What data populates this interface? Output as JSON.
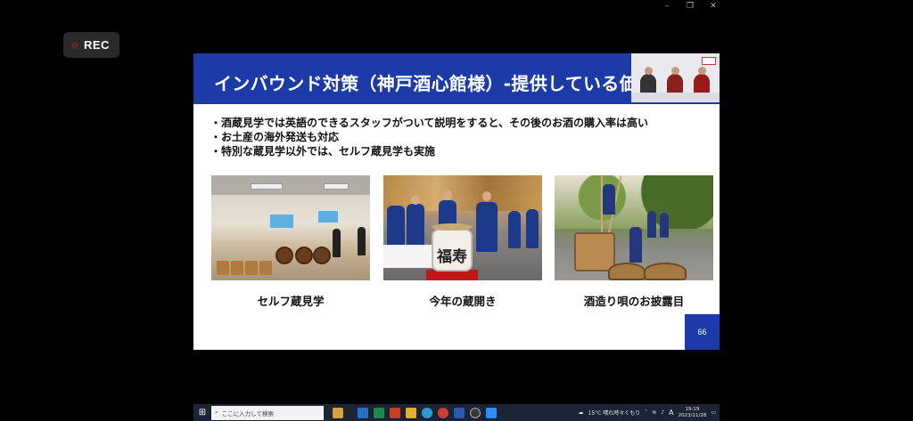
{
  "window": {
    "controls": [
      "–",
      "❐",
      "✕"
    ]
  },
  "rec_badge": {
    "label": "REC"
  },
  "slide": {
    "title": "インバウンド対策（神戸酒心館様）-提供している価",
    "bullets": [
      "酒蔵見学では英語のできるスタッフがついて説明をすると、その後のお酒の購入率は高い",
      "お土産の海外発送も対応",
      "特別な蔵見学以外では、セルフ蔵見学も実施"
    ],
    "photos": [
      {
        "caption": "セルフ蔵見学",
        "icon": "interior-photo"
      },
      {
        "caption": "今年の蔵開き",
        "icon": "ceremony-photo",
        "keg_text": "福寿"
      },
      {
        "caption": "酒造り唄のお披露目",
        "icon": "brewing-photo"
      }
    ],
    "page_number": "66"
  },
  "taskbar": {
    "start_icon": "⊞",
    "search_placeholder": "ここに入力して検索",
    "weather": "15°C 晴れ時々くもり",
    "ime": "A",
    "time": "19:19",
    "date": "2023/11/28"
  },
  "colors": {
    "slide_header": "#1c3aa8",
    "background": "#000000",
    "taskbar": "#1a2434"
  }
}
